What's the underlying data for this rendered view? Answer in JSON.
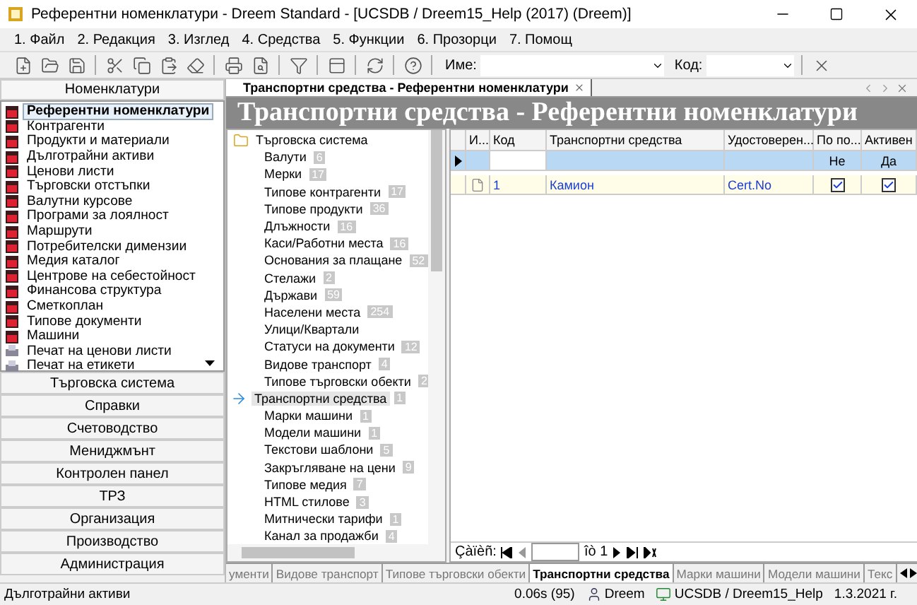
{
  "window": {
    "title": "Референтни номенклатури - Dreem Standard - [UCSDB / Dreem15_Help (2017) (Dreem)]"
  },
  "menu": [
    "1. Файл",
    "2. Редакция",
    "3. Изглед",
    "4. Средства",
    "5. Функции",
    "6. Прозорци",
    "7. Помощ"
  ],
  "toolbar": {
    "name_label": "Име:",
    "code_label": "Код:"
  },
  "navigator": {
    "header": "Номенклатури",
    "items": [
      {
        "label": "Референтни номенклатури",
        "selected": true,
        "kind": "book"
      },
      {
        "label": "Контрагенти",
        "selected": false,
        "kind": "book"
      },
      {
        "label": "Продукти и материали",
        "selected": false,
        "kind": "book"
      },
      {
        "label": "Дълготрайни активи",
        "selected": false,
        "kind": "book"
      },
      {
        "label": "Ценови листи",
        "selected": false,
        "kind": "book"
      },
      {
        "label": "Търговски отстъпки",
        "selected": false,
        "kind": "book"
      },
      {
        "label": "Валутни курсове",
        "selected": false,
        "kind": "book"
      },
      {
        "label": "Програми за лоялност",
        "selected": false,
        "kind": "book"
      },
      {
        "label": "Маршрути",
        "selected": false,
        "kind": "book"
      },
      {
        "label": "Потребителски димензии",
        "selected": false,
        "kind": "book"
      },
      {
        "label": "Медия каталог",
        "selected": false,
        "kind": "book"
      },
      {
        "label": "Центрове на себестойност",
        "selected": false,
        "kind": "book"
      },
      {
        "label": "Финансова структура",
        "selected": false,
        "kind": "book"
      },
      {
        "label": "Сметкоплан",
        "selected": false,
        "kind": "book"
      },
      {
        "label": "Типове документи",
        "selected": false,
        "kind": "book"
      },
      {
        "label": "Машини",
        "selected": false,
        "kind": "book"
      },
      {
        "label": "Печат на ценови листи",
        "selected": false,
        "kind": "print"
      },
      {
        "label": "Печат на етикети",
        "selected": false,
        "kind": "print"
      }
    ],
    "sections": [
      "Търговска система",
      "Справки",
      "Счетоводство",
      "Мениджмънт",
      "Контролен панел",
      "ТРЗ",
      "Организация",
      "Производство",
      "Администрация"
    ]
  },
  "document_tab": {
    "label": "Транспортни средства - Референтни номенклатури"
  },
  "page_title": "Транспортни средства - Референтни номенклатури",
  "tree": {
    "label": "Търговска система",
    "expanded": true,
    "children": [
      {
        "label": "Валути",
        "count": "6",
        "selected": false
      },
      {
        "label": "Мерки",
        "count": "17",
        "selected": false
      },
      {
        "label": "Типове контрагенти",
        "count": "17",
        "selected": false
      },
      {
        "label": "Типове продукти",
        "count": "36",
        "selected": false
      },
      {
        "label": "Длъжности",
        "count": "16",
        "selected": false
      },
      {
        "label": "Каси/Работни места",
        "count": "16",
        "selected": false
      },
      {
        "label": "Основания за плащане",
        "count": "52",
        "selected": false
      },
      {
        "label": "Стелажи",
        "count": "2",
        "selected": false
      },
      {
        "label": "Държави",
        "count": "59",
        "selected": false
      },
      {
        "label": "Населени места",
        "count": "254",
        "selected": false
      },
      {
        "label": "Улици/Квартали",
        "selected": false
      },
      {
        "label": "Статуси на документи",
        "count": "12",
        "selected": false
      },
      {
        "label": "Видове транспорт",
        "count": "4",
        "selected": false
      },
      {
        "label": "Типове търговски обекти",
        "count": "2",
        "selected": false
      },
      {
        "label": "Транспортни средства",
        "count": "1",
        "selected": true
      },
      {
        "label": "Марки машини",
        "count": "1",
        "selected": false
      },
      {
        "label": "Модели машини",
        "count": "1",
        "selected": false
      },
      {
        "label": "Текстови шаблони",
        "count": "5",
        "selected": false
      },
      {
        "label": "Закръгляване на цени",
        "count": "9",
        "selected": false
      },
      {
        "label": "Типове медия",
        "count": "7",
        "selected": false
      },
      {
        "label": "HTML стилове",
        "count": "3",
        "selected": false
      },
      {
        "label": "Митнически тарифи",
        "count": "1",
        "selected": false
      },
      {
        "label": "Канал за продажби",
        "count": "4",
        "selected": false
      }
    ]
  },
  "grid": {
    "columns": [
      {
        "label": "И..."
      },
      {
        "label": "Код"
      },
      {
        "label": "Транспортни средства"
      },
      {
        "label": "Удостоверен..."
      },
      {
        "label": "По по...",
        "filter": "Не"
      },
      {
        "label": "Активен",
        "filter": "Да"
      }
    ],
    "rows": [
      {
        "cells": [
          {
            "kind": "icon"
          },
          {
            "kind": "text",
            "text": "1"
          },
          {
            "kind": "text",
            "text": "Камион"
          },
          {
            "kind": "text",
            "text": "Cert.No"
          },
          {
            "kind": "check",
            "checked": true
          },
          {
            "kind": "check",
            "checked": true
          }
        ]
      }
    ]
  },
  "record_nav": {
    "label": "Çàïèñ:",
    "of": "îò 1"
  },
  "bottom_tabs": [
    {
      "label": "ументи",
      "selected": false
    },
    {
      "label": "Видове транспорт",
      "selected": false
    },
    {
      "label": "Типове търговски обекти",
      "selected": false
    },
    {
      "label": "Транспортни средства",
      "selected": true
    },
    {
      "label": "Марки машини",
      "selected": false
    },
    {
      "label": "Модели машини",
      "selected": false
    },
    {
      "label": "Текс",
      "selected": false
    }
  ],
  "status_bar": {
    "message": "Дълготрайни активи",
    "timing": "0.06s (95)",
    "user": "Dreem",
    "database": "UCSDB / Dreem15_Help",
    "date": "1.3.2021 г."
  }
}
